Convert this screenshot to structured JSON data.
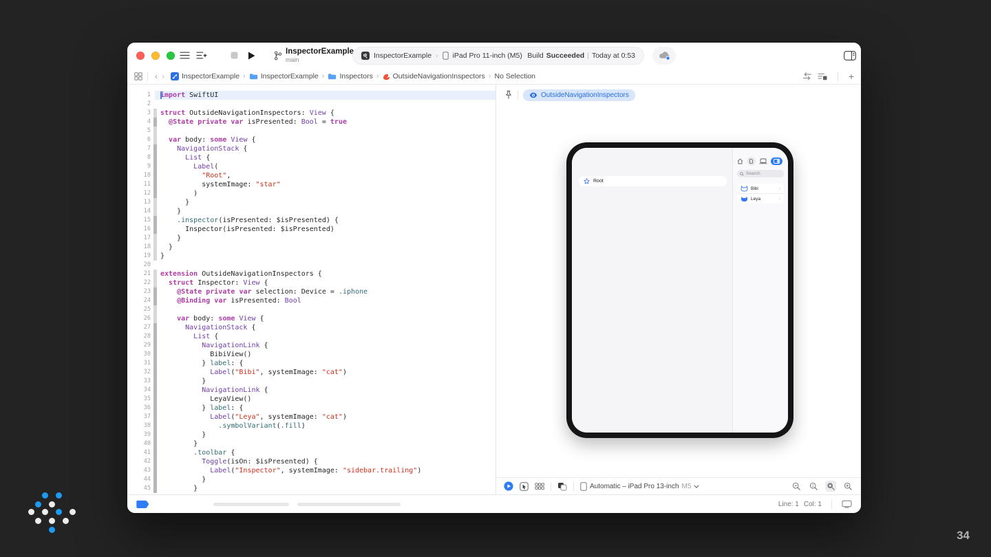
{
  "page": {
    "number": "34"
  },
  "colors": {
    "accent": "#2e7df6",
    "logo_blue": "#1d9bf0",
    "logo_white": "#ededed"
  },
  "toolbar": {
    "scheme_name": "InspectorExample",
    "branch_name": "main",
    "destination_project": "InspectorExample",
    "destination_separator": "›",
    "destination_device": "iPad Pro 11-inch (M5)",
    "build_label": "Build",
    "build_status": "Succeeded",
    "build_separator": "|",
    "build_time": "Today at 0:53"
  },
  "jumpbar": {
    "separator": "›",
    "back_chevron": "‹",
    "forward_chevron": "›",
    "add_label": "+",
    "items": [
      {
        "label": "InspectorExample",
        "icon": "project"
      },
      {
        "label": "InspectorExample",
        "icon": "folder"
      },
      {
        "label": "Inspectors",
        "icon": "folder"
      },
      {
        "label": "OutsideNavigationInspectors",
        "icon": "swift"
      },
      {
        "label": "No Selection",
        "icon": ""
      }
    ]
  },
  "editor": {
    "lines": [
      {
        "n": 1,
        "bar": 0,
        "toks": [
          [
            "k",
            "import"
          ],
          [
            "p",
            " SwiftUI"
          ]
        ]
      },
      {
        "n": 2,
        "bar": 0,
        "toks": []
      },
      {
        "n": 3,
        "bar": 1,
        "toks": [
          [
            "k",
            "struct"
          ],
          [
            "p",
            " OutsideNavigationInspectors: "
          ],
          [
            "t",
            "View"
          ],
          [
            "p",
            " {"
          ]
        ]
      },
      {
        "n": 4,
        "bar": 2,
        "toks": [
          [
            "p",
            "  "
          ],
          [
            "k",
            "@State"
          ],
          [
            "p",
            " "
          ],
          [
            "k",
            "private"
          ],
          [
            "p",
            " "
          ],
          [
            "k",
            "var"
          ],
          [
            "p",
            " isPresented: "
          ],
          [
            "t",
            "Bool"
          ],
          [
            "p",
            " = "
          ],
          [
            "k",
            "true"
          ]
        ]
      },
      {
        "n": 5,
        "bar": 1,
        "toks": []
      },
      {
        "n": 6,
        "bar": 1,
        "toks": [
          [
            "p",
            "  "
          ],
          [
            "k",
            "var"
          ],
          [
            "p",
            " body: "
          ],
          [
            "k",
            "some"
          ],
          [
            "p",
            " "
          ],
          [
            "t",
            "View"
          ],
          [
            "p",
            " {"
          ]
        ]
      },
      {
        "n": 7,
        "bar": 2,
        "toks": [
          [
            "p",
            "    "
          ],
          [
            "t",
            "NavigationStack"
          ],
          [
            "p",
            " {"
          ]
        ]
      },
      {
        "n": 8,
        "bar": 2,
        "toks": [
          [
            "p",
            "      "
          ],
          [
            "t",
            "List"
          ],
          [
            "p",
            " {"
          ]
        ]
      },
      {
        "n": 9,
        "bar": 2,
        "toks": [
          [
            "p",
            "        "
          ],
          [
            "t",
            "Label"
          ],
          [
            "p",
            "("
          ]
        ]
      },
      {
        "n": 10,
        "bar": 2,
        "toks": [
          [
            "p",
            "          "
          ],
          [
            "s",
            "\"Root\""
          ],
          [
            "p",
            ","
          ]
        ]
      },
      {
        "n": 11,
        "bar": 2,
        "toks": [
          [
            "p",
            "          systemImage: "
          ],
          [
            "s",
            "\"star\""
          ]
        ]
      },
      {
        "n": 12,
        "bar": 2,
        "toks": [
          [
            "p",
            "        )"
          ]
        ]
      },
      {
        "n": 13,
        "bar": 1,
        "toks": [
          [
            "p",
            "      }"
          ]
        ]
      },
      {
        "n": 14,
        "bar": 1,
        "toks": [
          [
            "p",
            "    }"
          ]
        ]
      },
      {
        "n": 15,
        "bar": 2,
        "toks": [
          [
            "p",
            "    "
          ],
          [
            "f",
            ".inspector"
          ],
          [
            "p",
            "(isPresented: $isPresented) {"
          ]
        ]
      },
      {
        "n": 16,
        "bar": 2,
        "toks": [
          [
            "p",
            "      Inspector(isPresented: $isPresented)"
          ]
        ]
      },
      {
        "n": 17,
        "bar": 1,
        "toks": [
          [
            "p",
            "    }"
          ]
        ]
      },
      {
        "n": 18,
        "bar": 1,
        "toks": [
          [
            "p",
            "  }"
          ]
        ]
      },
      {
        "n": 19,
        "bar": 1,
        "toks": [
          [
            "p",
            "}"
          ]
        ]
      },
      {
        "n": 20,
        "bar": 0,
        "toks": []
      },
      {
        "n": 21,
        "bar": 1,
        "toks": [
          [
            "k",
            "extension"
          ],
          [
            "p",
            " OutsideNavigationInspectors {"
          ]
        ]
      },
      {
        "n": 22,
        "bar": 1,
        "toks": [
          [
            "p",
            "  "
          ],
          [
            "k",
            "struct"
          ],
          [
            "p",
            " Inspector: "
          ],
          [
            "t",
            "View"
          ],
          [
            "p",
            " {"
          ]
        ]
      },
      {
        "n": 23,
        "bar": 2,
        "toks": [
          [
            "p",
            "    "
          ],
          [
            "k",
            "@State"
          ],
          [
            "p",
            " "
          ],
          [
            "k",
            "private"
          ],
          [
            "p",
            " "
          ],
          [
            "k",
            "var"
          ],
          [
            "p",
            " selection: Device = "
          ],
          [
            "f",
            ".iphone"
          ]
        ]
      },
      {
        "n": 24,
        "bar": 2,
        "toks": [
          [
            "p",
            "    "
          ],
          [
            "k",
            "@Binding"
          ],
          [
            "p",
            " "
          ],
          [
            "k",
            "var"
          ],
          [
            "p",
            " isPresented: "
          ],
          [
            "t",
            "Bool"
          ]
        ]
      },
      {
        "n": 25,
        "bar": 1,
        "toks": []
      },
      {
        "n": 26,
        "bar": 1,
        "toks": [
          [
            "p",
            "    "
          ],
          [
            "k",
            "var"
          ],
          [
            "p",
            " body: "
          ],
          [
            "k",
            "some"
          ],
          [
            "p",
            " "
          ],
          [
            "t",
            "View"
          ],
          [
            "p",
            " {"
          ]
        ]
      },
      {
        "n": 27,
        "bar": 2,
        "toks": [
          [
            "p",
            "      "
          ],
          [
            "t",
            "NavigationStack"
          ],
          [
            "p",
            " {"
          ]
        ]
      },
      {
        "n": 28,
        "bar": 2,
        "toks": [
          [
            "p",
            "        "
          ],
          [
            "t",
            "List"
          ],
          [
            "p",
            " {"
          ]
        ]
      },
      {
        "n": 29,
        "bar": 2,
        "toks": [
          [
            "p",
            "          "
          ],
          [
            "t",
            "NavigationLink"
          ],
          [
            "p",
            " {"
          ]
        ]
      },
      {
        "n": 30,
        "bar": 2,
        "toks": [
          [
            "p",
            "            BibiView()"
          ]
        ]
      },
      {
        "n": 31,
        "bar": 2,
        "toks": [
          [
            "p",
            "          } "
          ],
          [
            "f",
            "label"
          ],
          [
            "p",
            ": {"
          ]
        ]
      },
      {
        "n": 32,
        "bar": 2,
        "toks": [
          [
            "p",
            "            "
          ],
          [
            "t",
            "Label"
          ],
          [
            "p",
            "("
          ],
          [
            "s",
            "\"Bibi\""
          ],
          [
            "p",
            ", systemImage: "
          ],
          [
            "s",
            "\"cat\""
          ],
          [
            "p",
            ")"
          ]
        ]
      },
      {
        "n": 33,
        "bar": 2,
        "toks": [
          [
            "p",
            "          }"
          ]
        ]
      },
      {
        "n": 34,
        "bar": 2,
        "toks": [
          [
            "p",
            "          "
          ],
          [
            "t",
            "NavigationLink"
          ],
          [
            "p",
            " {"
          ]
        ]
      },
      {
        "n": 35,
        "bar": 2,
        "toks": [
          [
            "p",
            "            LeyaView()"
          ]
        ]
      },
      {
        "n": 36,
        "bar": 2,
        "toks": [
          [
            "p",
            "          } "
          ],
          [
            "f",
            "label"
          ],
          [
            "p",
            ": {"
          ]
        ]
      },
      {
        "n": 37,
        "bar": 2,
        "toks": [
          [
            "p",
            "            "
          ],
          [
            "t",
            "Label"
          ],
          [
            "p",
            "("
          ],
          [
            "s",
            "\"Leya\""
          ],
          [
            "p",
            ", systemImage: "
          ],
          [
            "s",
            "\"cat\""
          ],
          [
            "p",
            ")"
          ]
        ]
      },
      {
        "n": 38,
        "bar": 2,
        "toks": [
          [
            "p",
            "              "
          ],
          [
            "f",
            ".symbolVariant"
          ],
          [
            "p",
            "("
          ],
          [
            "f",
            ".fill"
          ],
          [
            "p",
            ")"
          ]
        ]
      },
      {
        "n": 39,
        "bar": 2,
        "toks": [
          [
            "p",
            "          }"
          ]
        ]
      },
      {
        "n": 40,
        "bar": 2,
        "toks": [
          [
            "p",
            "        }"
          ]
        ]
      },
      {
        "n": 41,
        "bar": 2,
        "toks": [
          [
            "p",
            "        "
          ],
          [
            "f",
            ".toolbar"
          ],
          [
            "p",
            " {"
          ]
        ]
      },
      {
        "n": 42,
        "bar": 2,
        "toks": [
          [
            "p",
            "          "
          ],
          [
            "t",
            "Toggle"
          ],
          [
            "p",
            "(isOn: $isPresented) {"
          ]
        ]
      },
      {
        "n": 43,
        "bar": 2,
        "toks": [
          [
            "p",
            "            "
          ],
          [
            "t",
            "Label"
          ],
          [
            "p",
            "("
          ],
          [
            "s",
            "\"Inspector\""
          ],
          [
            "p",
            ", systemImage: "
          ],
          [
            "s",
            "\"sidebar.trailing\""
          ],
          [
            "p",
            ")"
          ]
        ]
      },
      {
        "n": 44,
        "bar": 2,
        "toks": [
          [
            "p",
            "          }"
          ]
        ]
      },
      {
        "n": 45,
        "bar": 2,
        "toks": [
          [
            "p",
            "        }"
          ]
        ]
      }
    ]
  },
  "canvas": {
    "preview_name": "OutsideNavigationInspectors",
    "ipad": {
      "root_label": "Root",
      "inspector": {
        "search_placeholder": "Search",
        "row_chevron": "›",
        "rows": [
          {
            "label": "Bibi",
            "icon": "cat-outline"
          },
          {
            "label": "Leya",
            "icon": "cat-fill"
          }
        ]
      }
    },
    "bottom": {
      "device_label": "Automatic – iPad Pro 13-inch",
      "device_chip": "M5"
    }
  },
  "statusbar": {
    "line_label": "Line: 1",
    "col_label": "Col: 1"
  }
}
